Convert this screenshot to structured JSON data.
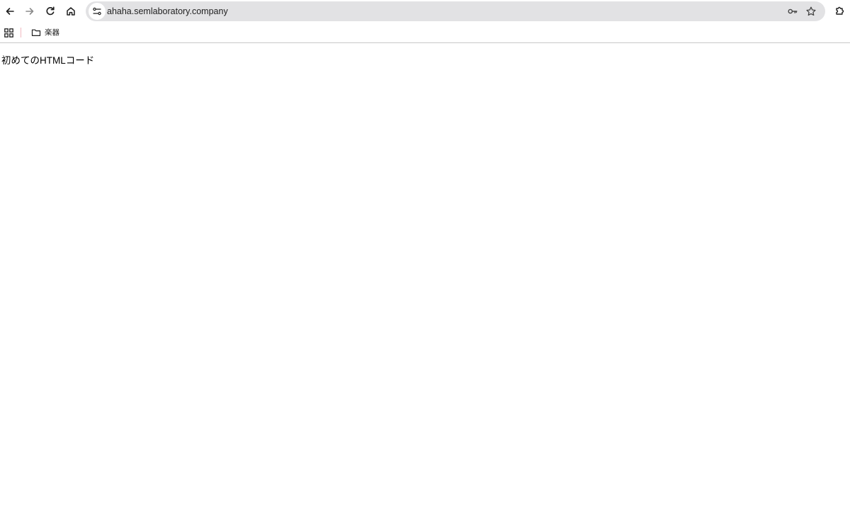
{
  "browser": {
    "url": "ahaha.semlaboratory.company",
    "nav": {
      "back_icon": "arrow-left-icon",
      "forward_icon": "arrow-right-icon",
      "reload_icon": "reload-icon",
      "home_icon": "home-icon"
    },
    "omnibox_icons": [
      "tune-icon",
      "key-icon",
      "star-icon"
    ],
    "extensions_icon": "puzzle-icon",
    "colors": {
      "omnibox_bg": "#e2e2e4",
      "toolbar_bg": "#ffffff",
      "divider_accent": "#f0b8c0"
    }
  },
  "bookmarks": {
    "apps_icon": "apps-grid-icon",
    "items": [
      {
        "label": "楽器",
        "icon": "folder-icon"
      }
    ]
  },
  "page": {
    "text": "初めてのHTMLコード"
  }
}
